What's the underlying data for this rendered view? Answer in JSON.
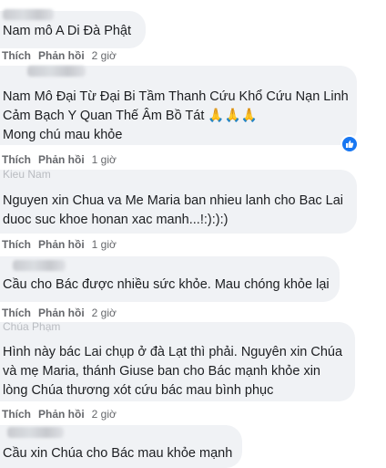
{
  "comments": [
    {
      "author": "",
      "lines": [
        "Nam mô A Di Đà Phật"
      ],
      "like": "Thích",
      "reply": "Phản hồi",
      "time": "2 giờ"
    },
    {
      "author": "",
      "lines": [
        "Nam Mô Đại Từ Đại Bi Tầm Thanh Cứu Khổ Cứu Nạn Linh",
        "Cảm Bạch Y Quan Thế Âm Bồ Tát 🙏🙏🙏",
        "Mong chú mau khỏe"
      ],
      "like": "Thích",
      "reply": "Phản hồi",
      "time": "1 giờ",
      "reaction_icon": "like-icon"
    },
    {
      "author": "Kieu Nam",
      "lines": [
        "Nguyen xin Chua va Me Maria ban nhieu lanh cho Bac Lai",
        "duoc suc khoe honan xac manh...!:):):)"
      ],
      "like": "Thích",
      "reply": "Phản hồi",
      "time": "1 giờ"
    },
    {
      "author": "",
      "lines": [
        "Cầu cho Bác được nhiều sức khỏe. Mau chóng khỏe lại"
      ],
      "like": "Thích",
      "reply": "Phản hồi",
      "time": "2 giờ"
    },
    {
      "author": "Chúa Phạm",
      "lines": [
        "Hình này bác Lai chụp ở đà Lạt thì phải. Nguyên xin Chúa",
        "và mẹ Maria, thánh Giuse ban cho Bác mạnh khỏe xin",
        "lòng Chúa thương xót cứu bác mau bình phục"
      ],
      "like": "Thích",
      "reply": "Phản hồi",
      "time": "2 giờ"
    },
    {
      "author": "",
      "lines": [
        "Cầu xin Chúa cho Bác mau khỏe mạnh"
      ]
    }
  ],
  "colors": {
    "bubble": "#f0f2f5",
    "action_text": "#65676b",
    "like_badge": "#1877f2"
  }
}
